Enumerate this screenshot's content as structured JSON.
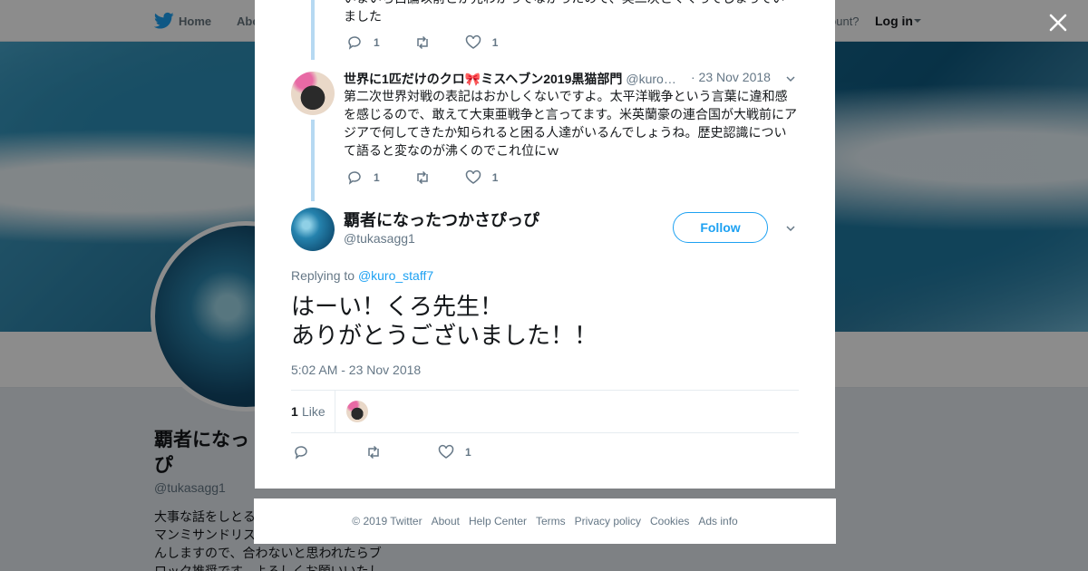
{
  "colors": {
    "accent": "#1da1f2",
    "thread_line": "#b6d9f2",
    "muted": "#657786",
    "text": "#14171a"
  },
  "topbar": {
    "home_label": "Home",
    "about_label": "Abo",
    "account_question": "ccount?",
    "login_label": "Log in"
  },
  "profile": {
    "name": "覇者になっ\nぴ",
    "handle": "@tukasagg1",
    "bio": "大事な話をしとる\nマンミサンドリス\nんしますので、合わないと思われたらブ\nロック推奨です。よろしくお願いいたし"
  },
  "modal": {
    "prev_tweet": {
      "text_tail": "いまいち白論以前とか先わかってなかったので、実二次とくくってしまってい\nました",
      "reply_count": "1",
      "retweet_count": "",
      "like_count": "1"
    },
    "reply_tweet": {
      "name": "世界に1匹だけのクロ🎀ミスヘブン2019黒猫部門",
      "handle": "@kuro…",
      "date": "· 23 Nov 2018",
      "text": "第二次世界対戦の表記はおかしくないですよ。太平洋戦争という言葉に違和感を感じるので、敢えて大東亜戦争と言ってます。米英蘭豪の連合国が大戦前にアジアで何してきたか知られると困る人達がいるんでしょうね。歴史認識について語ると変なのが沸くのでこれ位にｗ",
      "reply_count": "1",
      "retweet_count": "",
      "like_count": "1"
    },
    "main_tweet": {
      "name": "覇者になったつかさぴっぴ",
      "handle": "@tukasagg1",
      "follow_label": "Follow",
      "replying_prefix": "Replying to ",
      "replying_to": "@kuro_staff7",
      "text": "はーい！くろ先生！\nありがとうございました！！",
      "timestamp": "5:02 AM - 23 Nov 2018",
      "likes_number": "1",
      "likes_label": "Like",
      "reply_count": "",
      "retweet_count": "",
      "like_count": "1"
    }
  },
  "footer": {
    "links": [
      "© 2019 Twitter",
      "About",
      "Help Center",
      "Terms",
      "Privacy policy",
      "Cookies",
      "Ads info"
    ]
  }
}
